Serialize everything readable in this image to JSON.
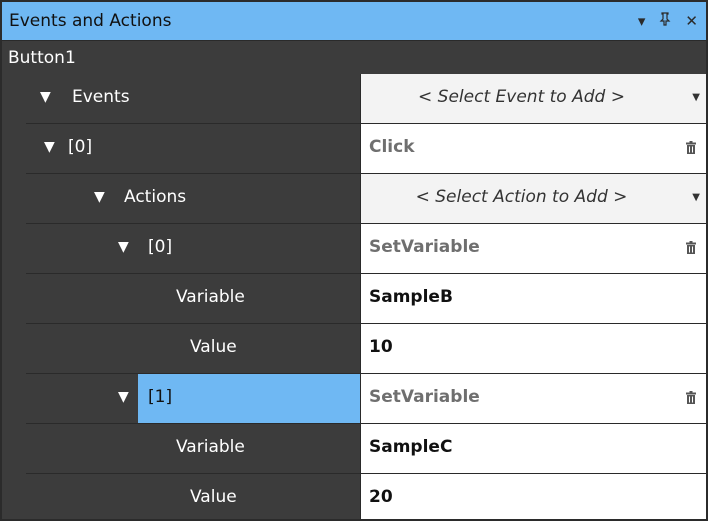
{
  "panel": {
    "title": "Events and Actions",
    "subtitle": "Button1",
    "buttons": {
      "dropdown": "▾",
      "pin": "ᛘ",
      "close": "✕"
    }
  },
  "tree": {
    "events_label": "Events",
    "events_select": "< Select Event to Add >",
    "event0_index": "[0]",
    "event0_value": "Click",
    "actions_label": "Actions",
    "actions_select": "< Select Action to Add >",
    "action0_index": "[0]",
    "action0_value": "SetVariable",
    "action0_var_label": "Variable",
    "action0_var_value": "SampleB",
    "action0_val_label": "Value",
    "action0_val_value": "10",
    "action1_index": "[1]",
    "action1_value": "SetVariable",
    "action1_var_label": "Variable",
    "action1_var_value": "SampleC",
    "action1_val_label": "Value",
    "action1_val_value": "20",
    "expand_glyph": "▼"
  },
  "icons": {
    "trash": "trash-icon",
    "caret": "caret-down-icon",
    "expand": "expand-arrow-icon"
  },
  "colors": {
    "title_bar": "#6fb8f3",
    "panel_bg": "#3c3c3c",
    "selection": "#6fb8f3",
    "value_grey": "#6f6f6f"
  }
}
